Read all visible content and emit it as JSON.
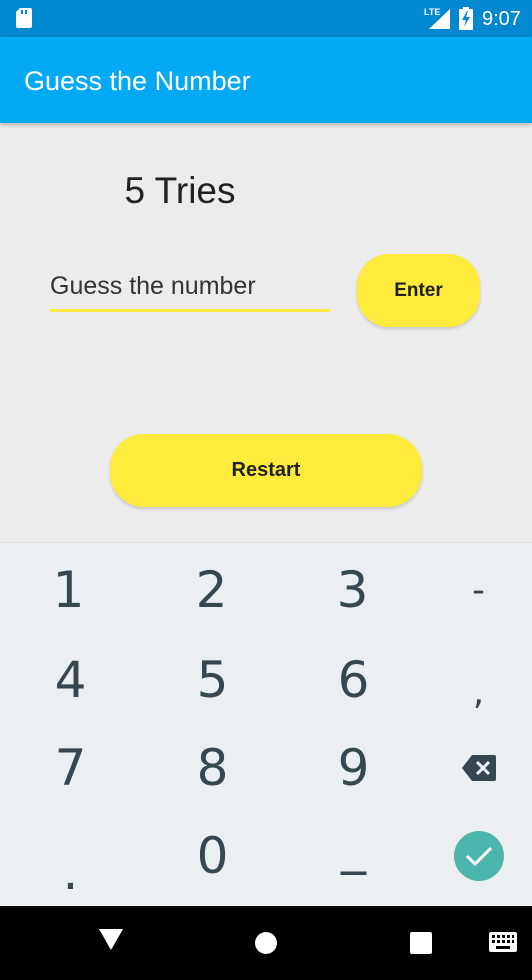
{
  "status_bar": {
    "time": "9:07",
    "network": "LTE",
    "icons": [
      "sd-card-icon",
      "signal-icon",
      "battery-charging-icon"
    ]
  },
  "app_bar": {
    "title": "Guess the Number",
    "color": "#03a9f4"
  },
  "main": {
    "tries_text": "5 Tries",
    "input_placeholder": "Guess the number",
    "input_value": "",
    "enter_label": "Enter",
    "restart_label": "Restart",
    "accent_color": "#ffeb3b"
  },
  "keyboard": {
    "keys": [
      "1",
      "2",
      "3",
      "-",
      "4",
      "5",
      ",",
      "6",
      "7",
      "8",
      "9",
      "0",
      ".",
      "_"
    ],
    "rows": [
      [
        "1",
        "2",
        "3",
        "-"
      ],
      [
        "4",
        "5",
        "6",
        ","
      ],
      [
        "7",
        "8",
        "9",
        "backspace-icon"
      ],
      [
        ".",
        "0",
        "_",
        "check-icon"
      ]
    ]
  },
  "nav_bar": {
    "icons": [
      "back-icon",
      "home-icon",
      "recents-icon",
      "keyboard-switch-icon"
    ]
  }
}
